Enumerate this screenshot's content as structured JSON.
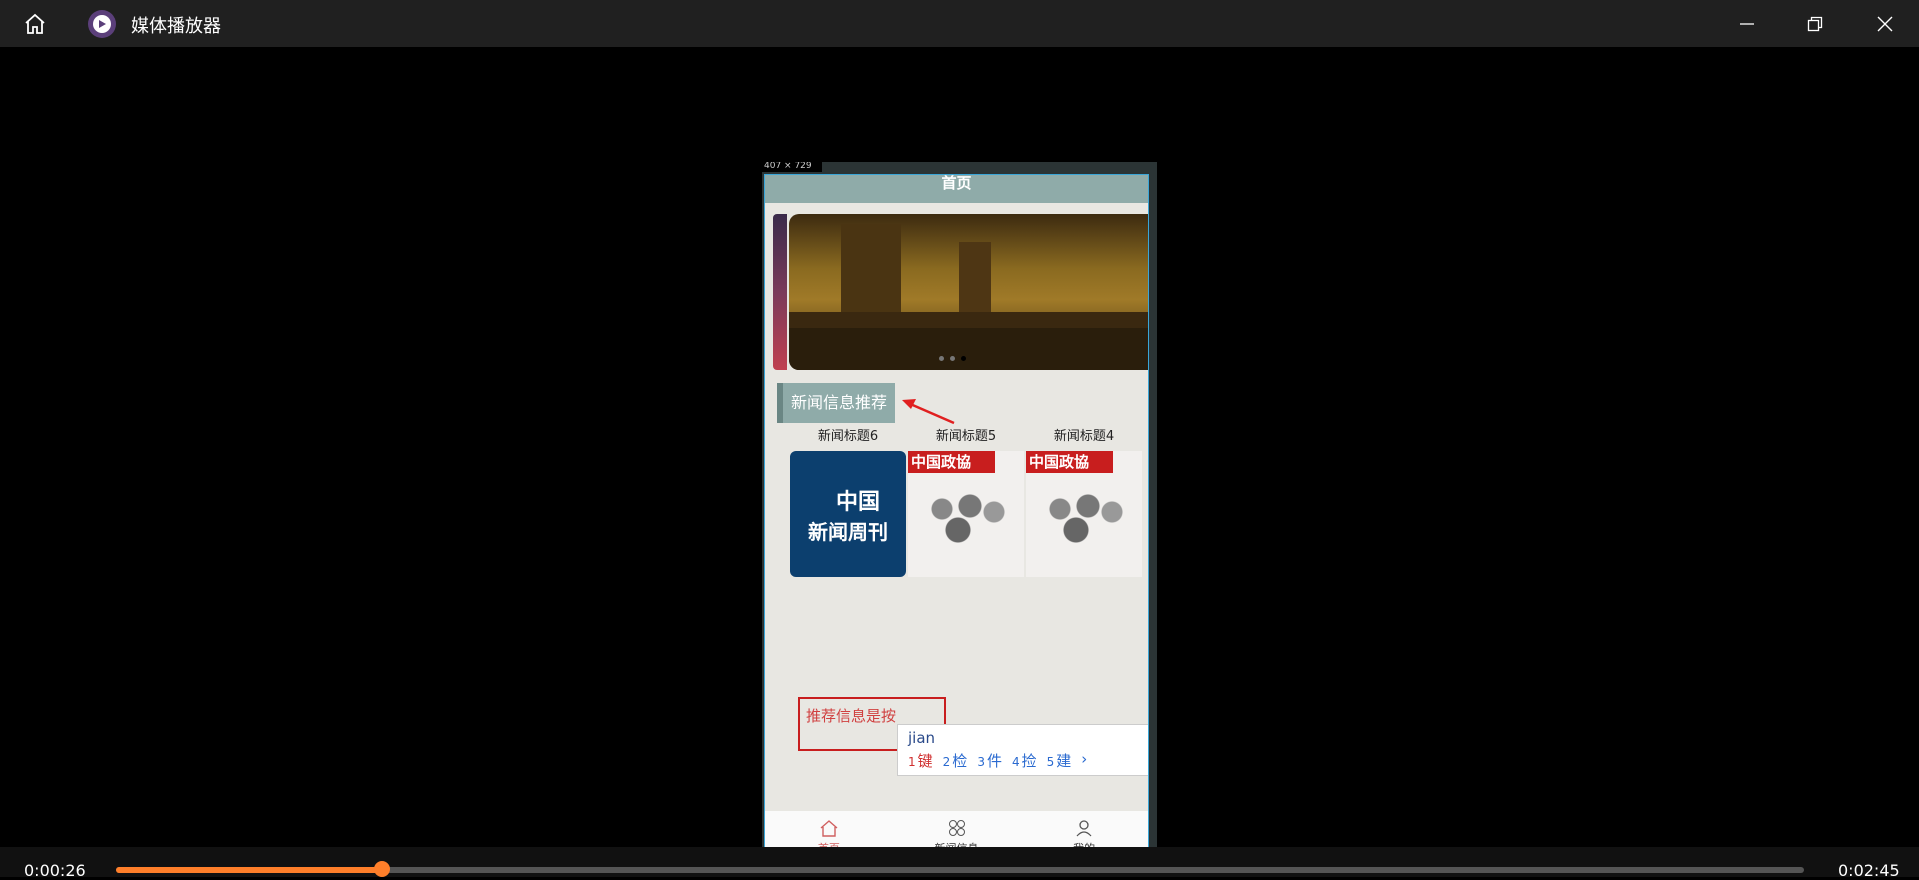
{
  "window": {
    "title": "媒体播放器"
  },
  "video": {
    "dimension_label": "407 × 729",
    "app": {
      "header_title": "首页",
      "section_title": "新闻信息推荐",
      "cards": [
        {
          "title": "新闻标题6",
          "image_text": [
            "中国",
            "新闻周刊"
          ]
        },
        {
          "title": "新闻标题5",
          "image_text": [
            "中国政協"
          ]
        },
        {
          "title": "新闻标题4",
          "image_text": [
            "中国政協"
          ]
        }
      ],
      "input_text": "推荐信息是按",
      "ime": {
        "pinyin": "jian",
        "candidates": [
          {
            "num": "1",
            "char": "键"
          },
          {
            "num": "2",
            "char": "检"
          },
          {
            "num": "3",
            "char": "件"
          },
          {
            "num": "4",
            "char": "捡"
          },
          {
            "num": "5",
            "char": "建"
          }
        ]
      },
      "tabs": [
        {
          "label": "首页",
          "icon": "home-icon",
          "active": true
        },
        {
          "label": "新闻信息",
          "icon": "grid-icon",
          "active": false
        },
        {
          "label": "我的",
          "icon": "user-icon",
          "active": false
        }
      ]
    }
  },
  "player": {
    "current_time": "0:00:26",
    "total_time": "0:02:45",
    "progress": 0.1576,
    "accent_color": "#ff7f2a"
  }
}
